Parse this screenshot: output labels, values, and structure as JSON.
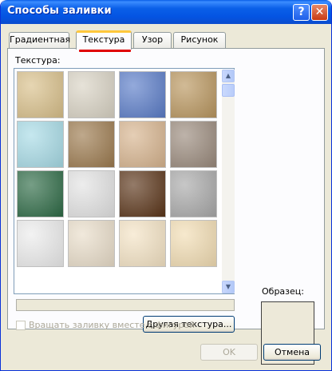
{
  "window": {
    "title": "Способы заливки",
    "help_glyph": "?",
    "close_glyph": "✕"
  },
  "tabs": [
    {
      "label": "Градиентная",
      "active": false
    },
    {
      "label": "Текстура",
      "active": true
    },
    {
      "label": "Узор",
      "active": false
    },
    {
      "label": "Рисунок",
      "active": false
    }
  ],
  "texture_label": "Текстура:",
  "texture_name": "",
  "other_texture_button": "Другая текстура...",
  "rotate_checkbox": {
    "label": "Вращать заливку вместе с фигурой",
    "checked": false,
    "enabled": false
  },
  "preview_label": "Образец:",
  "buttons": {
    "ok": "OK",
    "cancel": "Отмена"
  },
  "scrollbar": {
    "up_glyph": "▲",
    "down_glyph": "▼"
  },
  "textures": [
    {
      "name": "papyrus",
      "color": "#d9c08a"
    },
    {
      "name": "canvas",
      "color": "#d9d3c4"
    },
    {
      "name": "denim",
      "color": "#5a7cc8"
    },
    {
      "name": "woven-mat",
      "color": "#b9965e"
    },
    {
      "name": "water-droplets",
      "color": "#a7dbe6"
    },
    {
      "name": "paper-bag",
      "color": "#9c7a4e"
    },
    {
      "name": "fish-fossil",
      "color": "#d7b48e"
    },
    {
      "name": "sand",
      "color": "#9a8a7c"
    },
    {
      "name": "green-marble",
      "color": "#2d6a45"
    },
    {
      "name": "white-marble",
      "color": "#e3e3e3"
    },
    {
      "name": "brown-marble",
      "color": "#5a3418"
    },
    {
      "name": "granite",
      "color": "#a9a9a9"
    },
    {
      "name": "newsprint",
      "color": "#ececec"
    },
    {
      "name": "recycled-paper",
      "color": "#e9ddc9"
    },
    {
      "name": "parchment",
      "color": "#f4e3c4"
    },
    {
      "name": "stationery",
      "color": "#f2ddb3"
    }
  ]
}
